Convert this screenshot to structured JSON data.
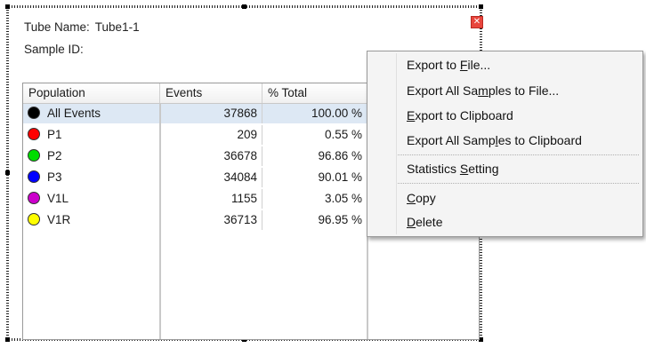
{
  "panel": {
    "tube_name_label": "Tube Name:",
    "tube_name": "Tube1-1",
    "sample_id_label": "Sample ID:",
    "sample_id": "",
    "close_glyph": "✕"
  },
  "table": {
    "headers": [
      "Population",
      "Events",
      "% Total",
      ""
    ],
    "rows": [
      {
        "name": "All Events",
        "color": "#000000",
        "events": "37868",
        "pct_total": "100.00 %"
      },
      {
        "name": "P1",
        "color": "#ff0000",
        "events": "209",
        "pct_total": "0.55 %"
      },
      {
        "name": "P2",
        "color": "#00dd00",
        "events": "36678",
        "pct_total": "96.86 %"
      },
      {
        "name": "P3",
        "color": "#0000ff",
        "events": "34084",
        "pct_total": "90.01 %"
      },
      {
        "name": "V1L",
        "color": "#cc00cc",
        "events": "1155",
        "pct_total": "3.05 %"
      },
      {
        "name": "V1R",
        "color": "#ffff00",
        "events": "36713",
        "pct_total": "96.95 %"
      }
    ]
  },
  "context_menu": {
    "items": [
      {
        "pre": "Export to ",
        "u": "F",
        "post": "ile..."
      },
      {
        "pre": "Export All Sa",
        "u": "m",
        "post": "ples to File..."
      },
      {
        "pre": "",
        "u": "E",
        "post": "xport to Clipboard"
      },
      {
        "pre": "Export All Samp",
        "u": "l",
        "post": "es to Clipboard"
      },
      {
        "pre": "Statistics ",
        "u": "S",
        "post": "etting"
      },
      {
        "pre": "",
        "u": "C",
        "post": "opy"
      },
      {
        "pre": "",
        "u": "D",
        "post": "elete"
      }
    ]
  }
}
